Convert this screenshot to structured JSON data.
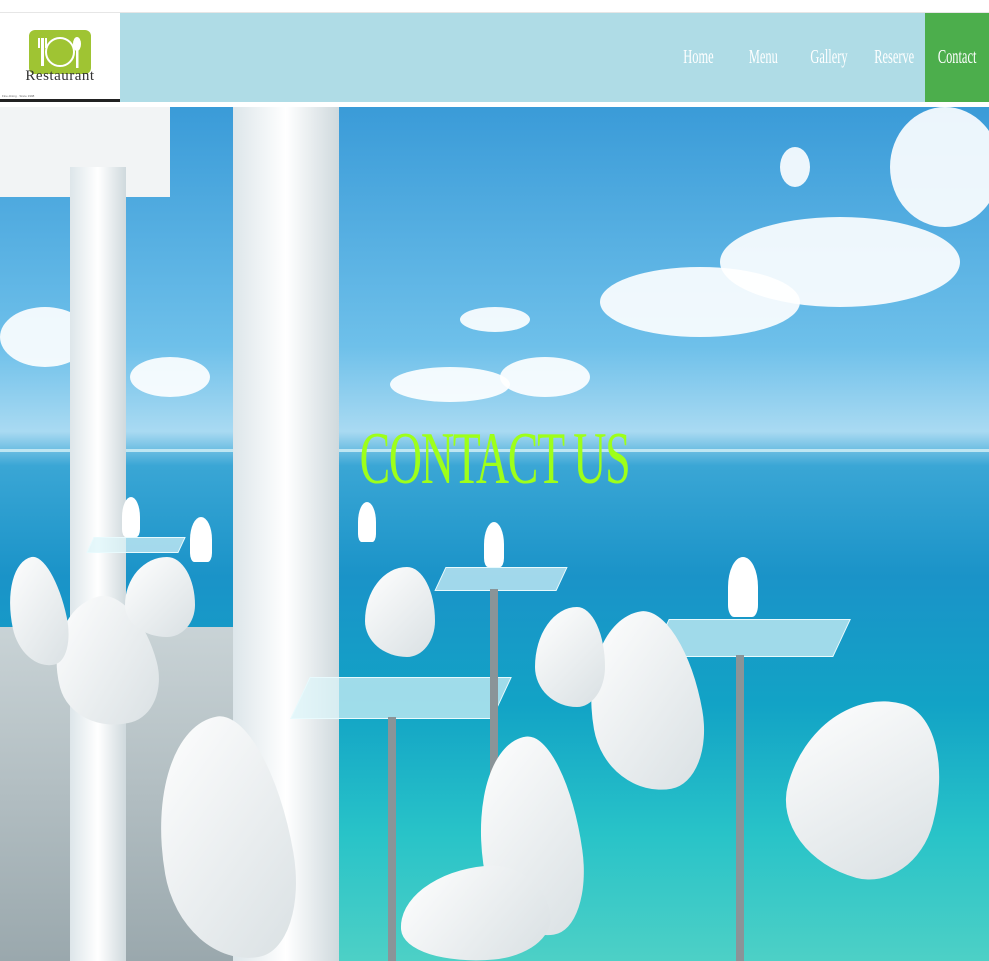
{
  "logo": {
    "name": "Restaurant",
    "tagline": "Fine dining · Since 1998"
  },
  "nav": {
    "items": [
      {
        "label": "Home",
        "active": false
      },
      {
        "label": "Menu",
        "active": false
      },
      {
        "label": "Gallery",
        "active": false
      },
      {
        "label": "Reserve",
        "active": false
      },
      {
        "label": "Contact",
        "active": true
      }
    ]
  },
  "hero": {
    "title": "CONTACT US"
  },
  "colors": {
    "header_bg": "#afdce6",
    "active_nav_bg": "#4cae4c",
    "title_color": "#9eff1a",
    "logo_mark": "#9fc433"
  },
  "icons": {
    "logo": "fork-knife-spoon-icon"
  }
}
